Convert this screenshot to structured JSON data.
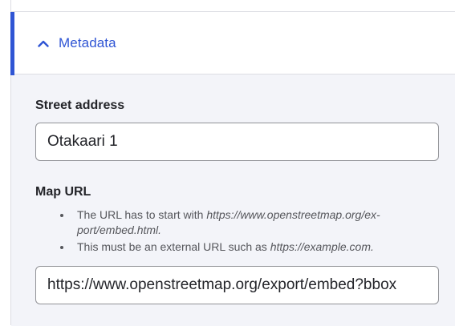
{
  "details": {
    "summary_label": "Metadata",
    "expanded": true,
    "accent_color": "#2f55d4"
  },
  "fields": {
    "street_address": {
      "label": "Street address",
      "value": "Otakaari 1"
    },
    "map_url": {
      "label": "Map URL",
      "value": "https://www.openstreetmap.org/export/embed?bbox",
      "description": {
        "item1_text": "The URL has to start with ",
        "item1_url_line1": "https://www.openstreetmap.org/ex-",
        "item1_url_line2": "port/embed.html.",
        "item2_text": "This must be an external URL such as ",
        "item2_url": "https://example.com."
      }
    }
  },
  "icons": {
    "summary_toggle": "chevron-up-icon"
  }
}
